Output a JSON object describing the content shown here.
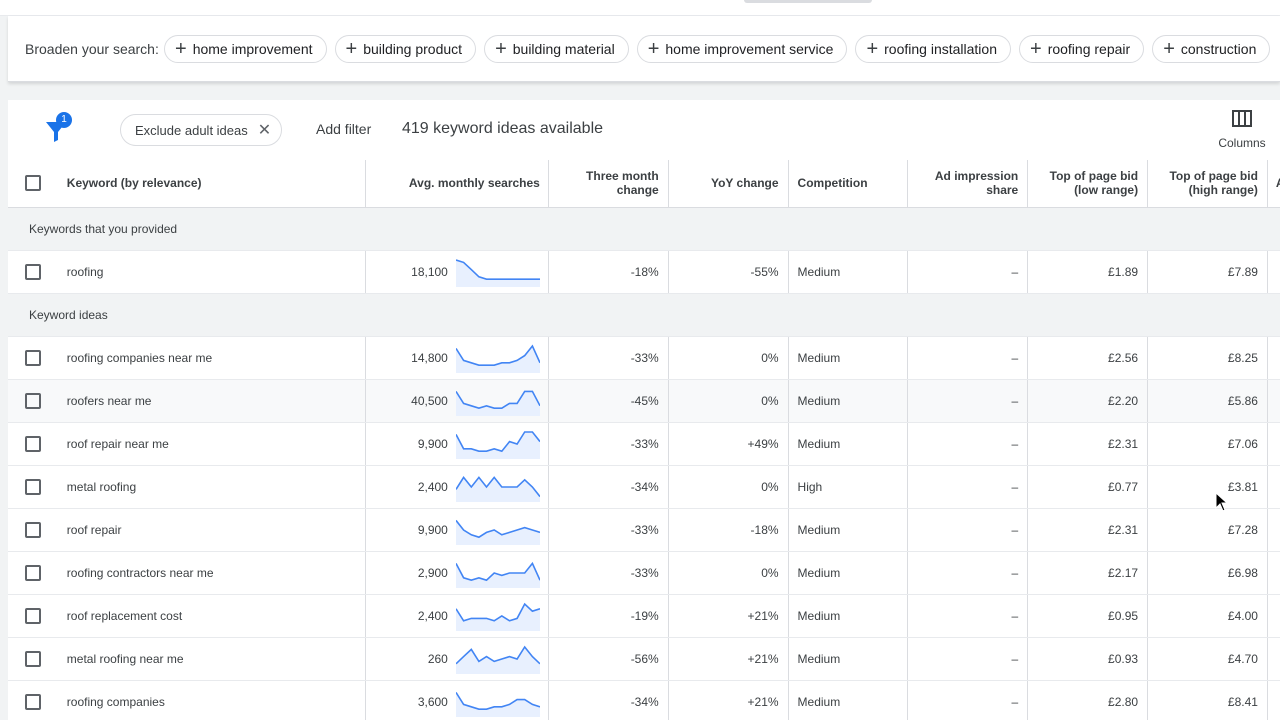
{
  "broaden": {
    "label": "Broaden your search:",
    "chips": [
      "home improvement",
      "building product",
      "building material",
      "home improvement service",
      "roofing installation",
      "roofing repair",
      "construction"
    ]
  },
  "toolbar": {
    "filter_badge": "1",
    "exclude_chip": "Exclude adult ideas",
    "add_filter": "Add filter",
    "ideas_count": "419 keyword ideas available",
    "columns_label": "Columns"
  },
  "table": {
    "headers": {
      "keyword": "Keyword (by relevance)",
      "avg": "Avg. monthly searches",
      "three_month": "Three month change",
      "yoy": "YoY change",
      "competition": "Competition",
      "ad_share": "Ad impression share",
      "bid_low": "Top of page bid (low range)",
      "bid_high": "Top of page bid (high range)",
      "acc": "Acc"
    },
    "section_provided": "Keywords that you provided",
    "section_ideas": "Keyword ideas",
    "provided": [
      {
        "keyword": "roofing",
        "avg": "18,100",
        "three": "-18%",
        "yoy": "-55%",
        "comp": "Medium",
        "ad": "–",
        "low": "£1.89",
        "high": "£7.89",
        "trend": [
          10,
          9,
          6,
          3,
          2,
          2,
          2,
          2,
          2,
          2,
          2,
          2
        ]
      }
    ],
    "ideas": [
      {
        "keyword": "roofing companies near me",
        "avg": "14,800",
        "three": "-33%",
        "yoy": "0%",
        "comp": "Medium",
        "ad": "–",
        "low": "£2.56",
        "high": "£8.25",
        "trend": [
          9,
          4,
          3,
          2,
          2,
          2,
          3,
          3,
          4,
          6,
          10,
          3
        ]
      },
      {
        "keyword": "roofers near me",
        "avg": "40,500",
        "three": "-45%",
        "yoy": "0%",
        "comp": "Medium",
        "ad": "–",
        "low": "£2.20",
        "high": "£5.86",
        "trend": [
          9,
          4,
          3,
          2,
          3,
          2,
          2,
          4,
          4,
          9,
          9,
          3
        ]
      },
      {
        "keyword": "roof repair near me",
        "avg": "9,900",
        "three": "-33%",
        "yoy": "+49%",
        "comp": "Medium",
        "ad": "–",
        "low": "£2.31",
        "high": "£7.06",
        "trend": [
          9,
          3,
          3,
          2,
          2,
          3,
          2,
          6,
          5,
          10,
          10,
          6
        ]
      },
      {
        "keyword": "metal roofing",
        "avg": "2,400",
        "three": "-34%",
        "yoy": "0%",
        "comp": "High",
        "ad": "–",
        "low": "£0.77",
        "high": "£3.81",
        "trend": [
          4,
          9,
          5,
          9,
          5,
          9,
          5,
          5,
          5,
          8,
          5,
          1
        ]
      },
      {
        "keyword": "roof repair",
        "avg": "9,900",
        "three": "-33%",
        "yoy": "-18%",
        "comp": "Medium",
        "ad": "–",
        "low": "£2.31",
        "high": "£7.28",
        "trend": [
          9,
          5,
          3,
          2,
          4,
          5,
          3,
          4,
          5,
          6,
          5,
          4
        ]
      },
      {
        "keyword": "roofing contractors near me",
        "avg": "2,900",
        "three": "-33%",
        "yoy": "0%",
        "comp": "Medium",
        "ad": "–",
        "low": "£2.17",
        "high": "£6.98",
        "trend": [
          9,
          3,
          2,
          3,
          2,
          5,
          4,
          5,
          5,
          5,
          9,
          2
        ]
      },
      {
        "keyword": "roof replacement cost",
        "avg": "2,400",
        "three": "-19%",
        "yoy": "+21%",
        "comp": "Medium",
        "ad": "–",
        "low": "£0.95",
        "high": "£4.00",
        "trend": [
          8,
          3,
          4,
          4,
          4,
          3,
          5,
          3,
          4,
          10,
          7,
          8
        ]
      },
      {
        "keyword": "metal roofing near me",
        "avg": "260",
        "three": "-56%",
        "yoy": "+21%",
        "comp": "Medium",
        "ad": "–",
        "low": "£0.93",
        "high": "£4.70",
        "trend": [
          3,
          6,
          9,
          4,
          6,
          4,
          5,
          6,
          5,
          10,
          6,
          3
        ]
      },
      {
        "keyword": "roofing companies",
        "avg": "3,600",
        "three": "-34%",
        "yoy": "+21%",
        "comp": "Medium",
        "ad": "–",
        "low": "£2.80",
        "high": "£8.41",
        "trend": [
          9,
          4,
          3,
          2,
          2,
          3,
          3,
          4,
          6,
          6,
          4,
          3
        ]
      }
    ]
  },
  "colors": {
    "accent": "#1a73e8",
    "sparkline": "#4285f4",
    "sparkline_fill": "#e8f0fe"
  }
}
